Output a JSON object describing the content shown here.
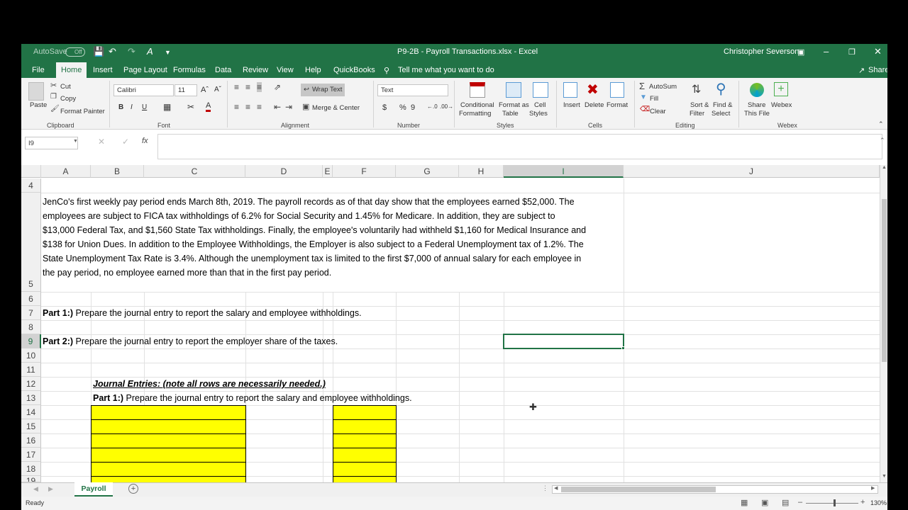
{
  "titlebar": {
    "autosave": "AutoSave",
    "autosave_state": "Off",
    "doc_title": "P9-2B - Payroll Transactions.xlsx  -  Excel",
    "user": "Christopher Severson"
  },
  "tabs": [
    "File",
    "Home",
    "Insert",
    "Page Layout",
    "Formulas",
    "Data",
    "Review",
    "View",
    "Help",
    "QuickBooks"
  ],
  "tell_me": "Tell me what you want to do",
  "share": "Share",
  "ribbon": {
    "clipboard": {
      "paste": "Paste",
      "cut": "Cut",
      "copy": "Copy",
      "format_painter": "Format Painter",
      "label": "Clipboard"
    },
    "font": {
      "name": "Calibri",
      "size": "11",
      "label": "Font"
    },
    "alignment": {
      "wrap": "Wrap Text",
      "merge": "Merge & Center",
      "label": "Alignment"
    },
    "number": {
      "format": "Text",
      "currency": "$",
      "percent": "%",
      "comma": "9",
      "label": "Number"
    },
    "styles": {
      "conditional": "Conditional",
      "conditional2": "Formatting",
      "format_as": "Format as",
      "format_as2": "Table",
      "cell": "Cell",
      "cell2": "Styles",
      "label": "Styles"
    },
    "cells": {
      "insert": "Insert",
      "delete": "Delete",
      "format": "Format",
      "label": "Cells"
    },
    "editing": {
      "autosum": "AutoSum",
      "fill": "Fill",
      "clear": "Clear",
      "sort": "Sort &",
      "sort2": "Filter",
      "find": "Find &",
      "find2": "Select",
      "label": "Editing"
    },
    "webex": {
      "share": "Share",
      "share2": "This File",
      "webex": "Webex",
      "label": "Webex"
    }
  },
  "formula_bar": {
    "name_box": "I9",
    "fx": "fx",
    "value": ""
  },
  "columns": [
    "A",
    "B",
    "C",
    "D",
    "E",
    "F",
    "G",
    "H",
    "I",
    "J"
  ],
  "rows": [
    "4",
    "5",
    "6",
    "7",
    "8",
    "9",
    "10",
    "11",
    "12",
    "13",
    "14",
    "15",
    "16",
    "17",
    "18",
    "19"
  ],
  "cells": {
    "a4_lines": [
      "JenCo's first weekly pay period ends March 8th, 2019. The payroll records as of that day show that the employees earned $52,000. The",
      "employees are subject to FICA tax withholdings of 6.2% for Social Security and 1.45% for Medicare. In addition, they are subject to",
      "$13,000 Federal Tax, and $1,560 State Tax withholdings. Finally, the employee's voluntarily had withheld $1,160 for Medical Insurance and",
      "$138 for Union Dues. In addition to the Employee Withholdings, the Employer is also subject to a Federal Unemployment tax of 1.2%. The",
      "State Unemployment Tax Rate is 3.4%. Although the unemployment tax is limited to the first $7,000 of annual salary for each employee in",
      "the pay period, no employee earned more than that in the first pay period."
    ],
    "a7_bold": "Part 1:)",
    "a7_text": " Prepare the journal entry to report the salary and employee withholdings.",
    "a9_bold": "Part 2:)",
    "a9_text": " Prepare the journal entry to report the employer share of the taxes.",
    "b12": "Journal Entries: (note all rows are necessarily needed.)",
    "b13_bold": "Part 1:)",
    "b13_text": " Prepare the journal entry to report the salary and employee withholdings."
  },
  "sheet_tab": "Payroll",
  "status": {
    "ready": "Ready",
    "zoom": "130%"
  },
  "colors": {
    "excel_green": "#217346",
    "highlight": "#ffff00"
  }
}
